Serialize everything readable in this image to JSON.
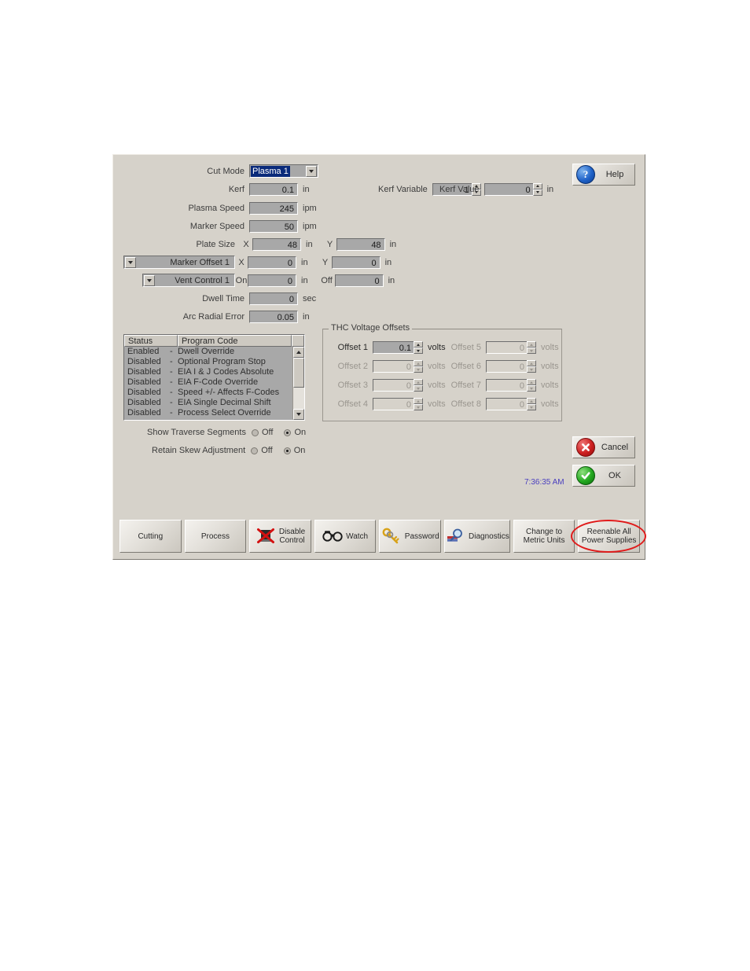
{
  "dialog": {
    "fields": {
      "cut_mode": {
        "label": "Cut Mode",
        "value": "Plasma 1"
      },
      "kerf": {
        "label": "Kerf",
        "value": "0.1",
        "unit": "in"
      },
      "kerf_variable": {
        "label": "Kerf Variable",
        "value": "1"
      },
      "kerf_value": {
        "label": "Kerf Value",
        "value": "0",
        "unit": "in"
      },
      "plasma_speed": {
        "label": "Plasma Speed",
        "value": "245",
        "unit": "ipm"
      },
      "marker_speed": {
        "label": "Marker Speed",
        "value": "50",
        "unit": "ipm"
      },
      "plate_size": {
        "label": "Plate Size",
        "x_axis": "X",
        "x_value": "48",
        "x_unit": "in",
        "y_axis": "Y",
        "y_value": "48",
        "y_unit": "in"
      },
      "marker_offset": {
        "label": "Marker Offset 1",
        "x_axis": "X",
        "x_value": "0",
        "x_unit": "in",
        "y_axis": "Y",
        "y_value": "0",
        "y_unit": "in"
      },
      "vent_control": {
        "label": "Vent Control 1",
        "on_axis": "On",
        "on_value": "0",
        "on_unit": "in",
        "off_axis": "Off",
        "off_value": "0",
        "off_unit": "in"
      },
      "dwell_time": {
        "label": "Dwell Time",
        "value": "0",
        "unit": "sec"
      },
      "arc_radial_error": {
        "label": "Arc Radial Error",
        "value": "0.05",
        "unit": "in"
      }
    },
    "program_code_list": {
      "headers": [
        "Status",
        "Program Code"
      ],
      "rows": [
        {
          "status": "Enabled",
          "dash": "-",
          "code": "Dwell Override"
        },
        {
          "status": "Disabled",
          "dash": "-",
          "code": "Optional Program Stop"
        },
        {
          "status": "Disabled",
          "dash": "-",
          "code": "EIA I & J Codes Absolute"
        },
        {
          "status": "Disabled",
          "dash": "-",
          "code": "EIA F-Code Override"
        },
        {
          "status": "Disabled",
          "dash": "-",
          "code": "Speed +/- Affects F-Codes"
        },
        {
          "status": "Disabled",
          "dash": "-",
          "code": "EIA Single Decimal Shift"
        },
        {
          "status": "Disabled",
          "dash": "-",
          "code": "Process Select Override"
        }
      ]
    },
    "thc_group": {
      "title": "THC Voltage Offsets",
      "unit": "volts",
      "offsets": [
        {
          "label": "Offset 1",
          "value": "0.1",
          "enabled": true
        },
        {
          "label": "Offset 2",
          "value": "0",
          "enabled": false
        },
        {
          "label": "Offset 3",
          "value": "0",
          "enabled": false
        },
        {
          "label": "Offset 4",
          "value": "0",
          "enabled": false
        },
        {
          "label": "Offset 5",
          "value": "0",
          "enabled": false
        },
        {
          "label": "Offset 6",
          "value": "0",
          "enabled": false
        },
        {
          "label": "Offset 7",
          "value": "0",
          "enabled": false
        },
        {
          "label": "Offset 8",
          "value": "0",
          "enabled": false
        }
      ]
    },
    "radios": [
      {
        "label": "Show Traverse Segments",
        "off_label": "Off",
        "on_label": "On",
        "selected": "On"
      },
      {
        "label": "Retain Skew Adjustment",
        "off_label": "Off",
        "on_label": "On",
        "selected": "On"
      }
    ],
    "action_buttons": {
      "help": {
        "label": "Help",
        "icon": "help-circle-icon"
      },
      "cancel": {
        "label": "Cancel",
        "icon": "red-x-circle-icon"
      },
      "ok": {
        "label": "OK",
        "icon": "green-check-circle-icon"
      }
    },
    "clock": "7:36:35 AM",
    "toolbar": [
      {
        "label": "Cutting",
        "icon": null
      },
      {
        "label": "Process",
        "icon": null
      },
      {
        "label": "Disable\nControl",
        "icon": "red-x-disable-icon"
      },
      {
        "label": "Watch",
        "icon": "binoculars-icon"
      },
      {
        "label": "Password",
        "icon": "keys-icon"
      },
      {
        "label": "Diagnostics",
        "icon": "magnifier-stack-icon"
      },
      {
        "label": "Change to\nMetric Units",
        "icon": null
      },
      {
        "label": "Reenable All\nPower Supplies",
        "icon": null,
        "annotated": true
      }
    ]
  },
  "colors": {
    "dialog_bg": "#d6d2ca",
    "field_bg": "#a8a8a8",
    "selection_blue": "#0a2a7a",
    "annotation_red": "#e01b1b",
    "clock_text": "#4a3fbf"
  }
}
